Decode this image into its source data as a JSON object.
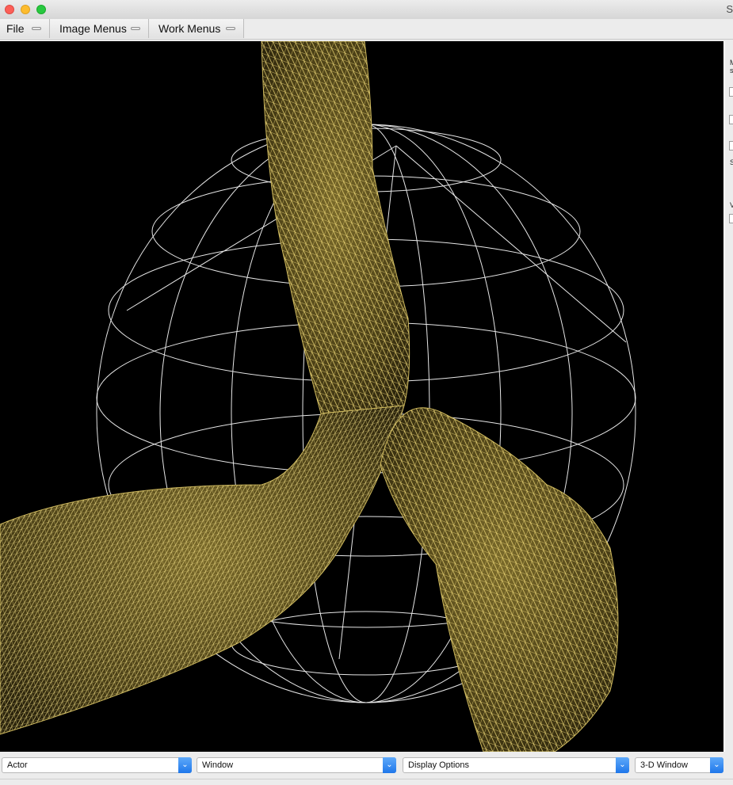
{
  "window": {
    "title_fragment": "S"
  },
  "menubar": {
    "file": "File",
    "image_menus": "Image Menus",
    "work_menus": "Work Menus"
  },
  "viewport": {
    "background": "#000000",
    "mesh_color": "#d8c26a",
    "sphere_color": "#e8e8e8"
  },
  "side_panel": {
    "fragments": [
      "M",
      "s",
      "S",
      "V"
    ]
  },
  "bottom_bar": {
    "actor": "Actor",
    "window": "Window",
    "display_options": "Display Options",
    "view_3d": "3-D Window",
    "chevron": "⌄"
  }
}
